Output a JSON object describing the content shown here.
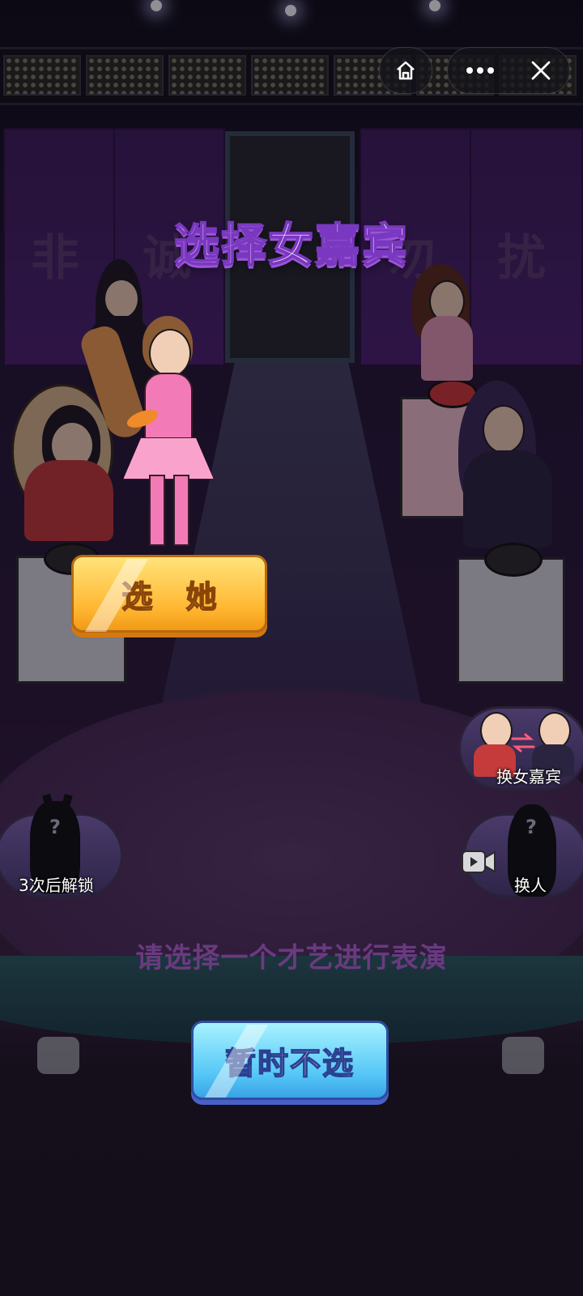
{
  "title": "选择女嘉宾",
  "background": {
    "panel_chars": [
      "非",
      "诚",
      "勿",
      "扰"
    ]
  },
  "select_button": {
    "label": "选 她"
  },
  "skip_button": {
    "label": "暂时不选"
  },
  "hint": "请选择一个才艺进行表演",
  "side_buttons": {
    "swap_guests": {
      "label": "换女嘉宾"
    },
    "unlock": {
      "label": "3次后解锁",
      "icon": "lock-silhouette-icon"
    },
    "change_person": {
      "label": "换人",
      "icon": "video-icon"
    }
  },
  "top_bar": {
    "home": "home-icon",
    "more": "more-icon",
    "close": "close-icon"
  },
  "colors": {
    "title": "#f5e4ff",
    "title_stroke": "#7a38c0",
    "select_button": "#ffb732",
    "skip_button": "#54c6f6",
    "hint": "#6a3a80"
  }
}
